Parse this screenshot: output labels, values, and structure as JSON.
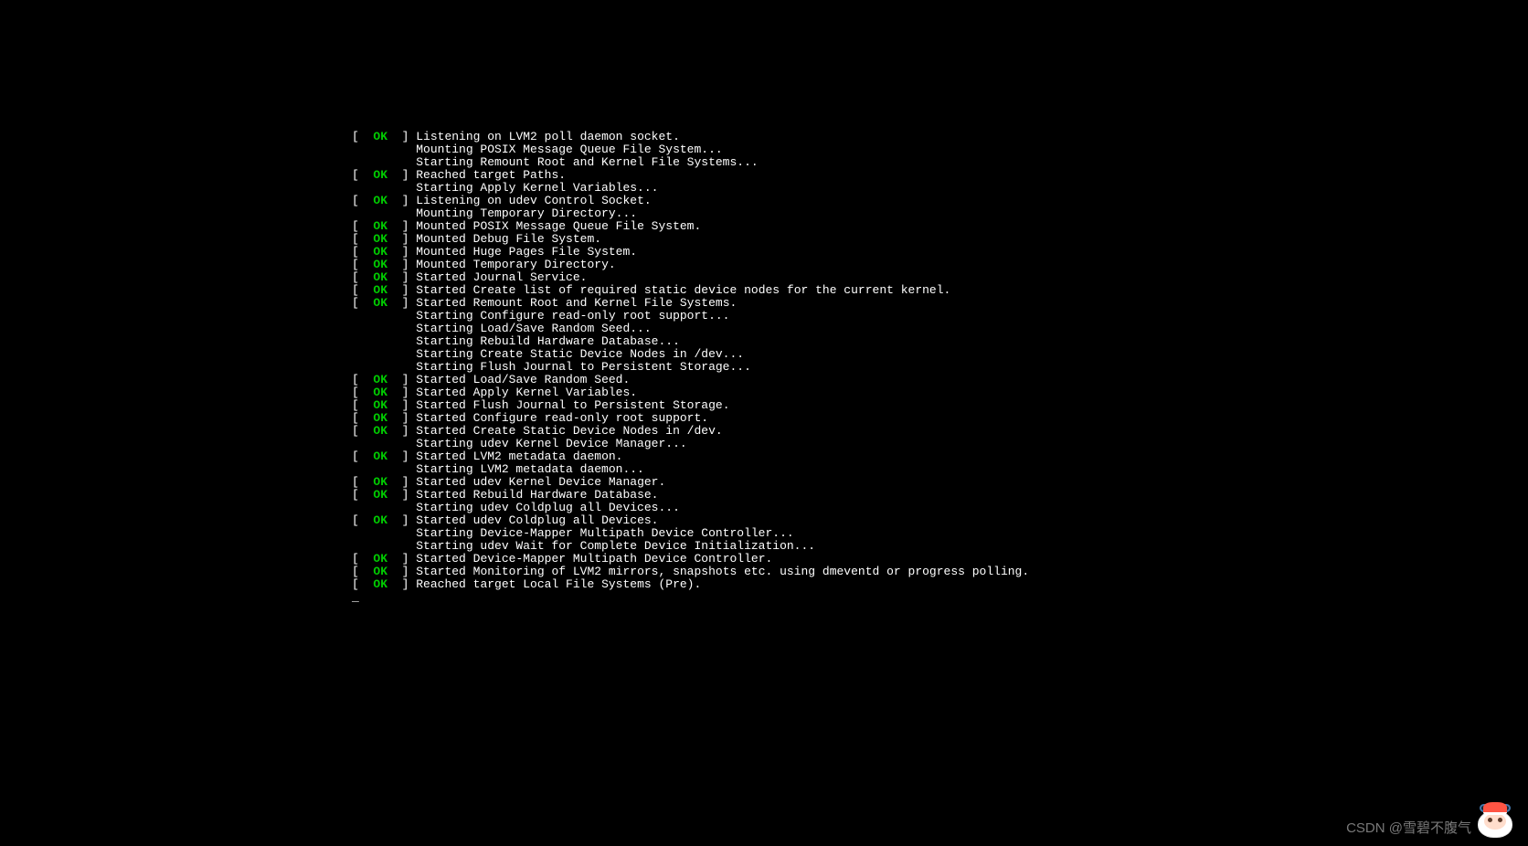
{
  "status_ok": "OK",
  "watermark": "CSDN @雪碧不腹气",
  "lines": [
    {
      "status": true,
      "msg": "Listening on LVM2 poll daemon socket."
    },
    {
      "status": false,
      "msg": "Mounting POSIX Message Queue File System..."
    },
    {
      "status": false,
      "msg": "Starting Remount Root and Kernel File Systems..."
    },
    {
      "status": true,
      "msg": "Reached target Paths."
    },
    {
      "status": false,
      "msg": "Starting Apply Kernel Variables..."
    },
    {
      "status": true,
      "msg": "Listening on udev Control Socket."
    },
    {
      "status": false,
      "msg": "Mounting Temporary Directory..."
    },
    {
      "status": true,
      "msg": "Mounted POSIX Message Queue File System."
    },
    {
      "status": true,
      "msg": "Mounted Debug File System."
    },
    {
      "status": true,
      "msg": "Mounted Huge Pages File System."
    },
    {
      "status": true,
      "msg": "Mounted Temporary Directory."
    },
    {
      "status": true,
      "msg": "Started Journal Service."
    },
    {
      "status": true,
      "msg": "Started Create list of required static device nodes for the current kernel."
    },
    {
      "status": true,
      "msg": "Started Remount Root and Kernel File Systems."
    },
    {
      "status": false,
      "msg": "Starting Configure read-only root support..."
    },
    {
      "status": false,
      "msg": "Starting Load/Save Random Seed..."
    },
    {
      "status": false,
      "msg": "Starting Rebuild Hardware Database..."
    },
    {
      "status": false,
      "msg": "Starting Create Static Device Nodes in /dev..."
    },
    {
      "status": false,
      "msg": "Starting Flush Journal to Persistent Storage..."
    },
    {
      "status": true,
      "msg": "Started Load/Save Random Seed."
    },
    {
      "status": true,
      "msg": "Started Apply Kernel Variables."
    },
    {
      "status": true,
      "msg": "Started Flush Journal to Persistent Storage."
    },
    {
      "status": true,
      "msg": "Started Configure read-only root support."
    },
    {
      "status": true,
      "msg": "Started Create Static Device Nodes in /dev."
    },
    {
      "status": false,
      "msg": "Starting udev Kernel Device Manager..."
    },
    {
      "status": true,
      "msg": "Started LVM2 metadata daemon."
    },
    {
      "status": false,
      "msg": "Starting LVM2 metadata daemon..."
    },
    {
      "status": true,
      "msg": "Started udev Kernel Device Manager."
    },
    {
      "status": true,
      "msg": "Started Rebuild Hardware Database."
    },
    {
      "status": false,
      "msg": "Starting udev Coldplug all Devices..."
    },
    {
      "status": true,
      "msg": "Started udev Coldplug all Devices."
    },
    {
      "status": false,
      "msg": "Starting Device-Mapper Multipath Device Controller..."
    },
    {
      "status": false,
      "msg": "Starting udev Wait for Complete Device Initialization..."
    },
    {
      "status": true,
      "msg": "Started Device-Mapper Multipath Device Controller."
    },
    {
      "status": true,
      "msg": "Started Monitoring of LVM2 mirrors, snapshots etc. using dmeventd or progress polling."
    },
    {
      "status": true,
      "msg": "Reached target Local File Systems (Pre)."
    }
  ]
}
